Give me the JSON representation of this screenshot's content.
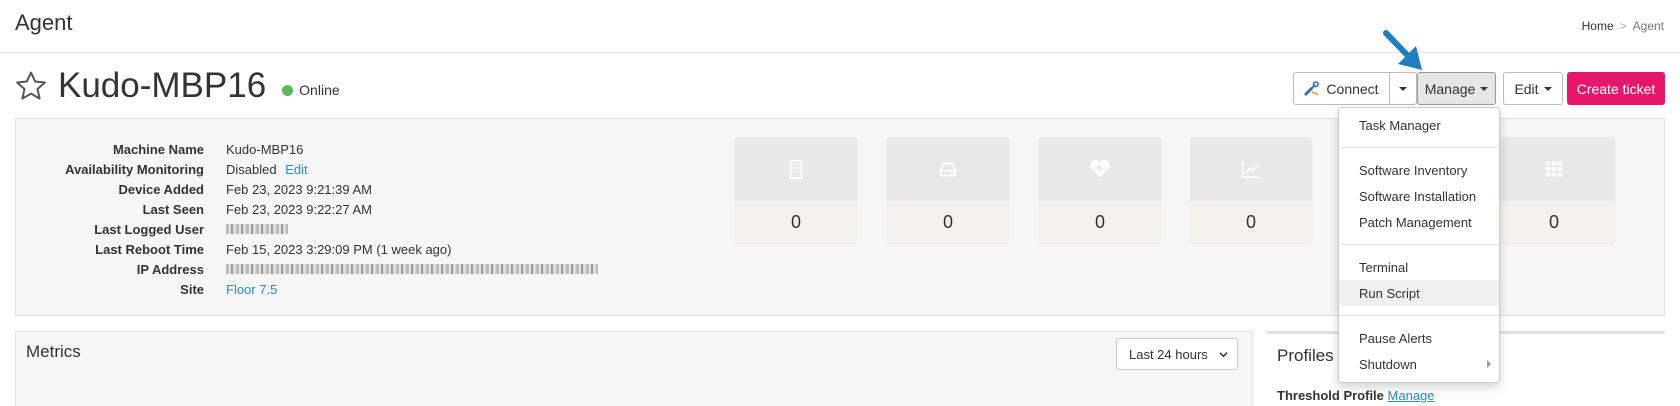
{
  "app": {
    "title": "Agent"
  },
  "breadcrumb": {
    "home": "Home",
    "separator": ">",
    "current": "Agent"
  },
  "device": {
    "name": "Kudo-MBP16",
    "status": "Online",
    "status_color": "#5cb85c"
  },
  "toolbar": {
    "connect_label": "Connect",
    "manage_label": "Manage",
    "edit_label": "Edit",
    "create_ticket_label": "Create ticket",
    "create_ticket_color": "#e8166a"
  },
  "info": {
    "rows": [
      {
        "label": "Machine Name",
        "value": "Kudo-MBP16"
      },
      {
        "label": "Availability Monitoring",
        "value": "Disabled",
        "link": "Edit"
      },
      {
        "label": "Device Added",
        "value": "Feb 23, 2023 9:21:39 AM"
      },
      {
        "label": "Last Seen",
        "value": "Feb 23, 2023 9:22:27 AM"
      },
      {
        "label": "Last Logged User",
        "value": ""
      },
      {
        "label": "Last Reboot Time",
        "value": "Feb 15, 2023 3:29:09 PM (1 week ago)"
      },
      {
        "label": "IP Address",
        "value": ""
      },
      {
        "label": "Site",
        "link": "Floor 7.5"
      }
    ]
  },
  "tiles": [
    {
      "icon": "building-icon",
      "count": "0"
    },
    {
      "icon": "hard-drive-icon",
      "count": "0"
    },
    {
      "icon": "heart-pulse-icon",
      "count": "0"
    },
    {
      "icon": "line-chart-icon",
      "count": "0"
    },
    {
      "icon": "grid-apps-icon",
      "count": "0"
    }
  ],
  "metrics": {
    "title": "Metrics",
    "range_selected": "Last 24 hours"
  },
  "profiles": {
    "title": "Profiles",
    "threshold_label": "Threshold Profile",
    "threshold_link": "Manage"
  },
  "manage_menu": {
    "items": [
      "Task Manager",
      "Software Inventory",
      "Software Installation",
      "Patch Management",
      "Terminal",
      "Run Script",
      "Pause Alerts",
      "Shutdown"
    ]
  },
  "colors": {
    "link": "#2a8ac4",
    "arrow": "#1f7fbf"
  }
}
